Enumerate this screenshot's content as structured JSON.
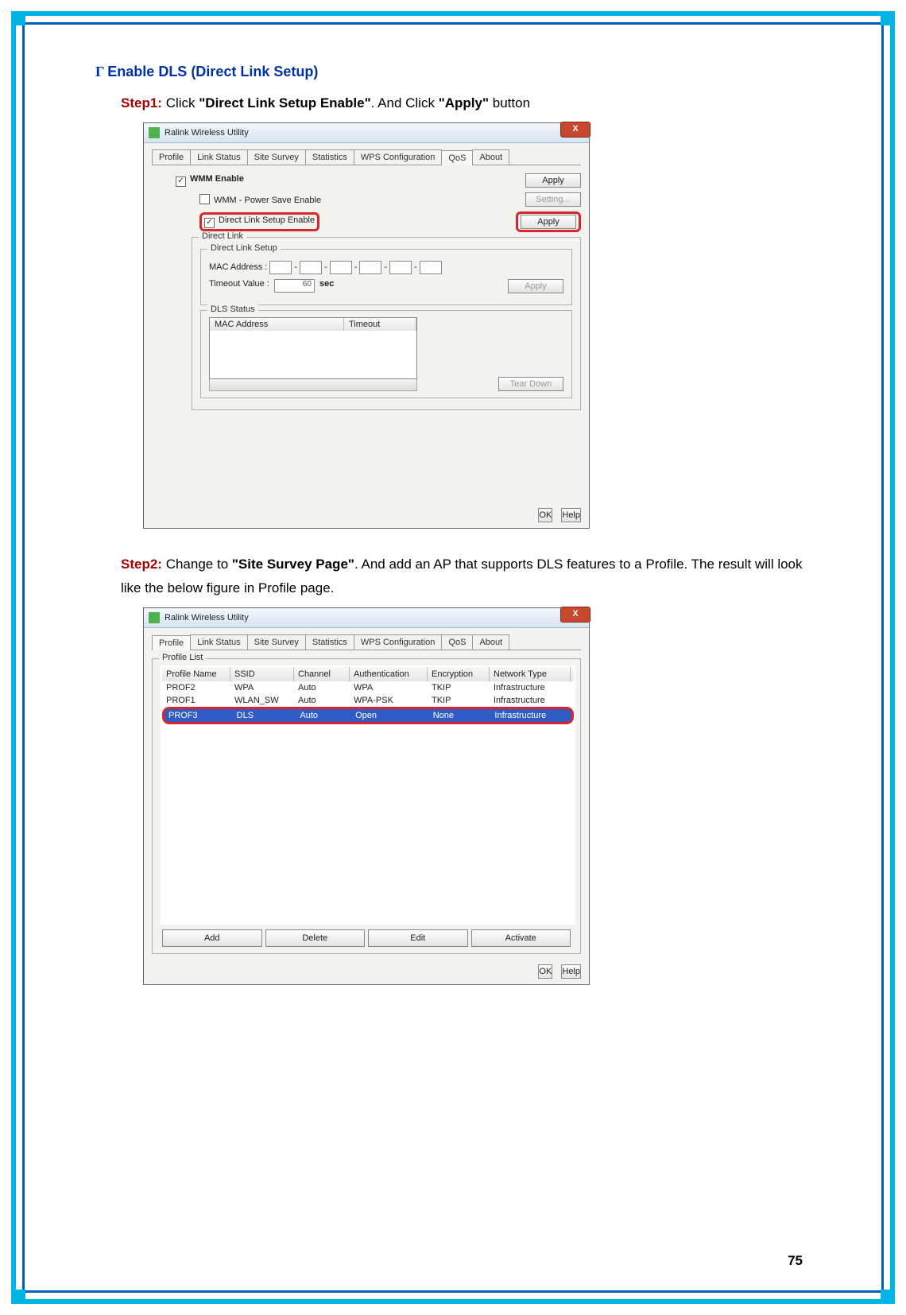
{
  "page_number": "75",
  "heading": "Enable DLS (Direct Link Setup)",
  "step1": {
    "label": "Step1:",
    "pre": " Click ",
    "q1": "\"Direct Link Setup Enable\"",
    "mid": ". And Click ",
    "q2": "\"Apply\"",
    "post": " button"
  },
  "step2": {
    "label": "Step2:",
    "pre": " Change to ",
    "q1": "\"Site Survey Page\"",
    "post": ". And add an AP that supports DLS features to a Profile. The result will look like the below figure in Profile page."
  },
  "win_title": "Ralink Wireless Utility",
  "close_btn": "X",
  "tabs": [
    "Profile",
    "Link Status",
    "Site Survey",
    "Statistics",
    "WPS Configuration",
    "QoS",
    "About"
  ],
  "fig1": {
    "wmm_enable": "WMM Enable",
    "power_save": "WMM - Power Save Enable",
    "dls_enable": "Direct Link Setup Enable",
    "apply": "Apply",
    "setting": "Setting...",
    "direct_link": "Direct Link",
    "direct_link_setup": "Direct Link Setup",
    "mac": "MAC Address :",
    "timeout_label": "Timeout Value :",
    "timeout_val": "60",
    "timeout_unit": "sec",
    "dls_status": "DLS Status",
    "th_mac": "MAC Address",
    "th_timeout": "Timeout",
    "teardown": "Tear Down",
    "ok": "OK",
    "help": "Help"
  },
  "fig2": {
    "profile_list": "Profile List",
    "headers": [
      "Profile Name",
      "SSID",
      "Channel",
      "Authentication",
      "Encryption",
      "Network Type"
    ],
    "rows": [
      {
        "c": [
          "PROF2",
          "WPA",
          "Auto",
          "WPA",
          "TKIP",
          "Infrastructure"
        ]
      },
      {
        "c": [
          "PROF1",
          "WLAN_SW",
          "Auto",
          "WPA-PSK",
          "TKIP",
          "Infrastructure"
        ]
      },
      {
        "c": [
          "PROF3",
          "DLS",
          "Auto",
          "Open",
          "None",
          "Infrastructure"
        ],
        "sel": true
      }
    ],
    "add": "Add",
    "delete": "Delete",
    "edit": "Edit",
    "activate": "Activate",
    "ok": "OK",
    "help": "Help"
  }
}
